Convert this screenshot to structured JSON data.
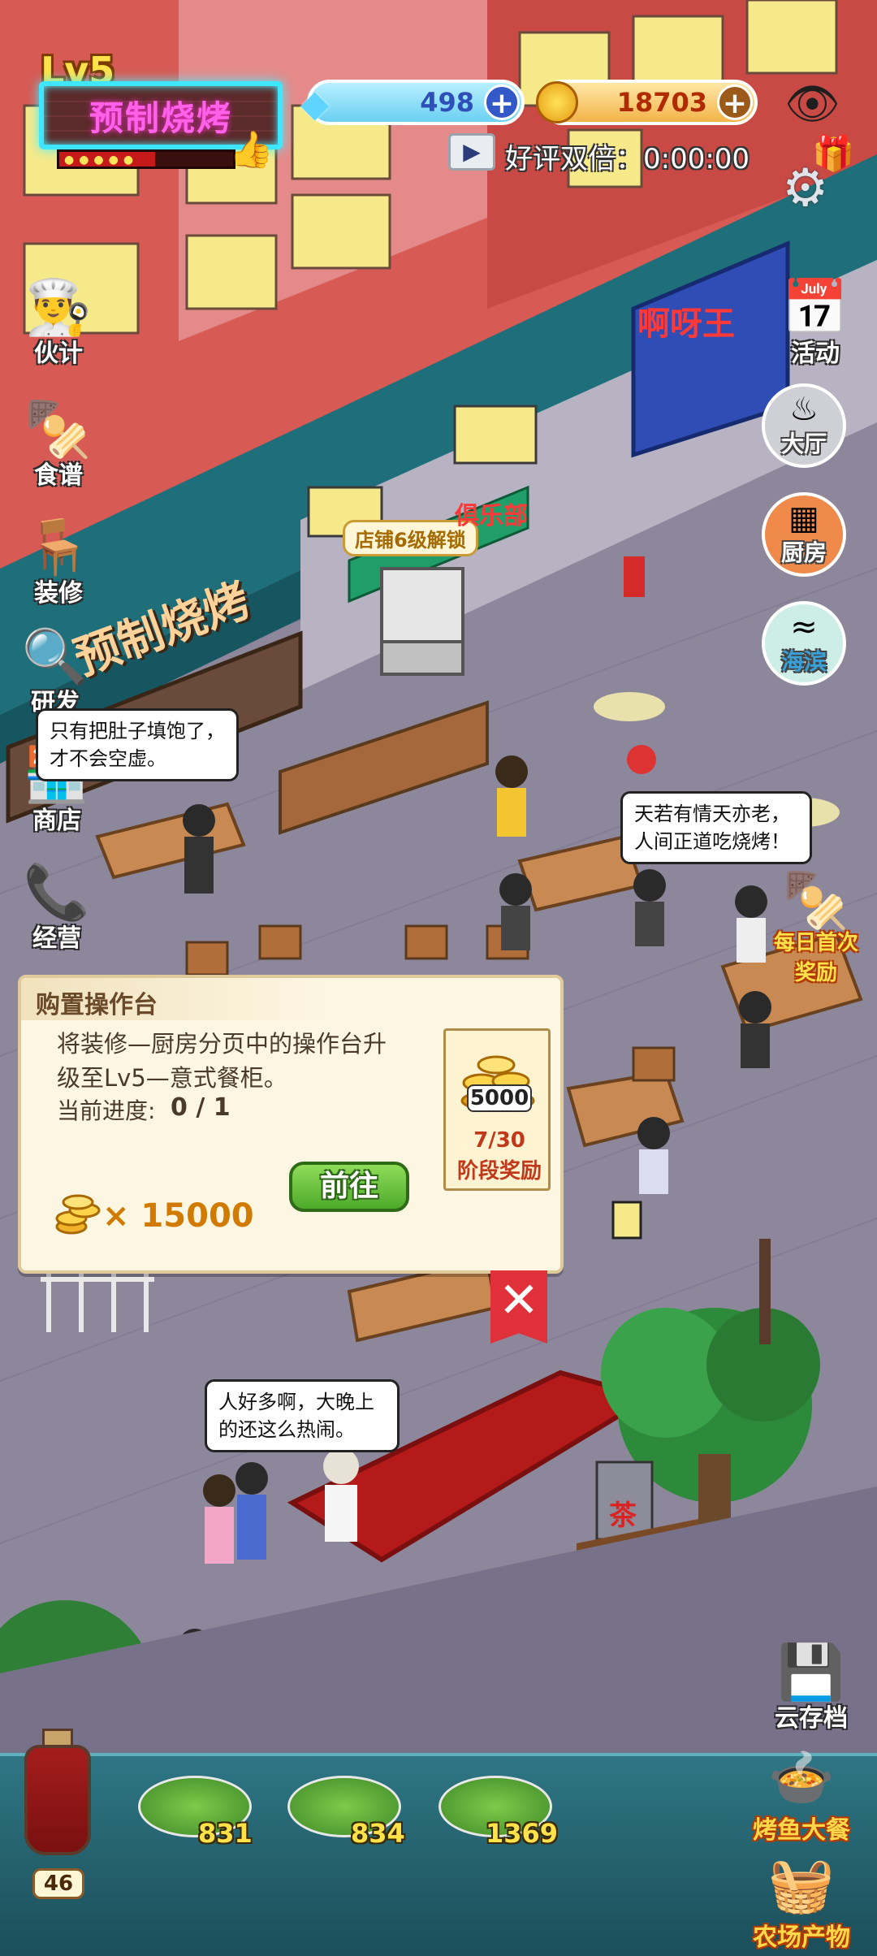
{
  "hud": {
    "level": "Lv5",
    "shop_name": "预制烧烤",
    "gems": "498",
    "coins": "18703",
    "double_reviews": "好评双倍：0:00:00",
    "star_progress": 0.55
  },
  "left_menu": [
    {
      "label": "伙计",
      "icon": "chef-icon"
    },
    {
      "label": "食谱",
      "icon": "skewer-icon"
    },
    {
      "label": "装修",
      "icon": "table-icon"
    },
    {
      "label": "研发",
      "icon": "magnifier-icon"
    },
    {
      "label": "商店",
      "icon": "shop-icon"
    },
    {
      "label": "经营",
      "icon": "phone-icon"
    }
  ],
  "right_menu": {
    "activity": "活动",
    "hall": "大厅",
    "kitchen": "厨房",
    "seaside": "海滨",
    "daily_reward": "每日首次奖励",
    "cloud_save": "云存档",
    "fish_feast": "烤鱼大餐",
    "farm_produce": "农场产物"
  },
  "scene": {
    "store_sign": "预制烧烤",
    "unlock_tag": "店铺6级解锁",
    "building_sign": "啊呀王",
    "club_sign": "俱乐部",
    "bubble_1": "只有把肚子填饱了，才不会空虚。",
    "bubble_2": "天若有情天亦老，人间正道吃烧烤！",
    "bubble_3": "人好多啊，大晚上的还这么热闹。",
    "tea_sign": "茶"
  },
  "task": {
    "title": "购置操作台",
    "description": "将装修—厨房分页中的操作台升级至Lv5—意式餐柜。",
    "progress_label": "当前进度:",
    "progress_value": "0 / 1",
    "cost": "× 15000",
    "go_button": "前往",
    "reward_amount": "5000",
    "reward_progress": "7/30",
    "reward_label": "阶段奖励"
  },
  "bottom": {
    "bottle_count": "46",
    "dishes": [
      {
        "name": "dish-1",
        "count": "831"
      },
      {
        "name": "dish-2",
        "count": "834"
      },
      {
        "name": "dish-3",
        "count": "1369"
      }
    ]
  }
}
